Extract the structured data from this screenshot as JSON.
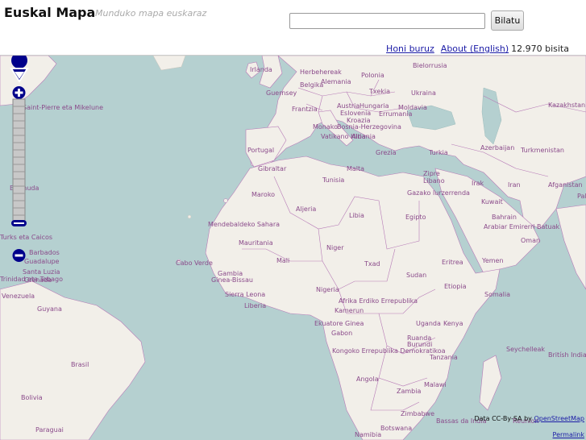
{
  "header": {
    "title": "Euskal Mapa",
    "subtitle": "Munduko mapa euskaraz",
    "search_placeholder": "",
    "search_button": "Bilatu",
    "links": [
      {
        "label": "Honi buruz"
      },
      {
        "label": "About (English)"
      }
    ],
    "visits": "12.970 bisita"
  },
  "map": {
    "labels": [
      "Irlanda",
      "Herbehereak",
      "Polonia",
      "Bielorrusia",
      "Alemania",
      "Belgika",
      "Txekia",
      "Ukraina",
      "Guernsey",
      "Frantzia",
      "Austria",
      "Hungaria",
      "Moldavia",
      "Eslovenia",
      "Errumania",
      "Kroazia",
      "Kazakhstan",
      "Monako",
      "Bosnia-Herzegovina",
      "Vatikano Hiria",
      "Albania",
      "Portugal",
      "Grezia",
      "Turkia",
      "Azerbaijan",
      "Turkmenistan",
      "Gibraltar",
      "Malta",
      "Tunisia",
      "Zipre",
      "Libano",
      "Maroko",
      "Gazako lurzerrenda",
      "Irak",
      "Iran",
      "Afganistan",
      "Aljeria",
      "Libia",
      "Egipto",
      "Kuwait",
      "Bahrain",
      "Arabiar Emirerri Batuak",
      "Mendebaldeko Sahara",
      "Mauritania",
      "Niger",
      "Oman",
      "Mali",
      "Txad",
      "Eritrea",
      "Yemen",
      "Cabo Verde",
      "Gambia",
      "Ginea-Bissau",
      "Sudan",
      "Sierra Leona",
      "Liberia",
      "Nigeria",
      "Etiopia",
      "Somalia",
      "Afrika Erdiko Errepublika",
      "Kamerun",
      "Ekuatore Ginea",
      "Gabon",
      "Uganda",
      "Kenya",
      "Ruanda",
      "Burundi",
      "Kongoko Errepublika Demokratikoa",
      "Tanzania",
      "Seychelleak",
      "Britísh Indian",
      "Angola",
      "Malawi",
      "Zambia",
      "Zimbabwe",
      "Bassas da India",
      "Reunion",
      "Botswana",
      "Namibia",
      "Saint-Pierre eta Mikelune",
      "Bermuda",
      "Turks eta Caicos",
      "Guadalupe",
      "Santa Luzia",
      "Barbados",
      "Trinidad eta Tobago",
      "Grenada",
      "Venezuela",
      "Guyana",
      "Brasil",
      "Bolivia",
      "Paraguai",
      "Pal"
    ],
    "attribution_prefix": "Data CC-By-SA by",
    "attribution_link": "OpenStreetMap",
    "permalink": "Permalink"
  },
  "colors": {
    "sea": "#b5d0d0",
    "land": "#f2efe9",
    "border": "#b77bb7",
    "label": "#8a4a8a",
    "control": "#00008b"
  }
}
